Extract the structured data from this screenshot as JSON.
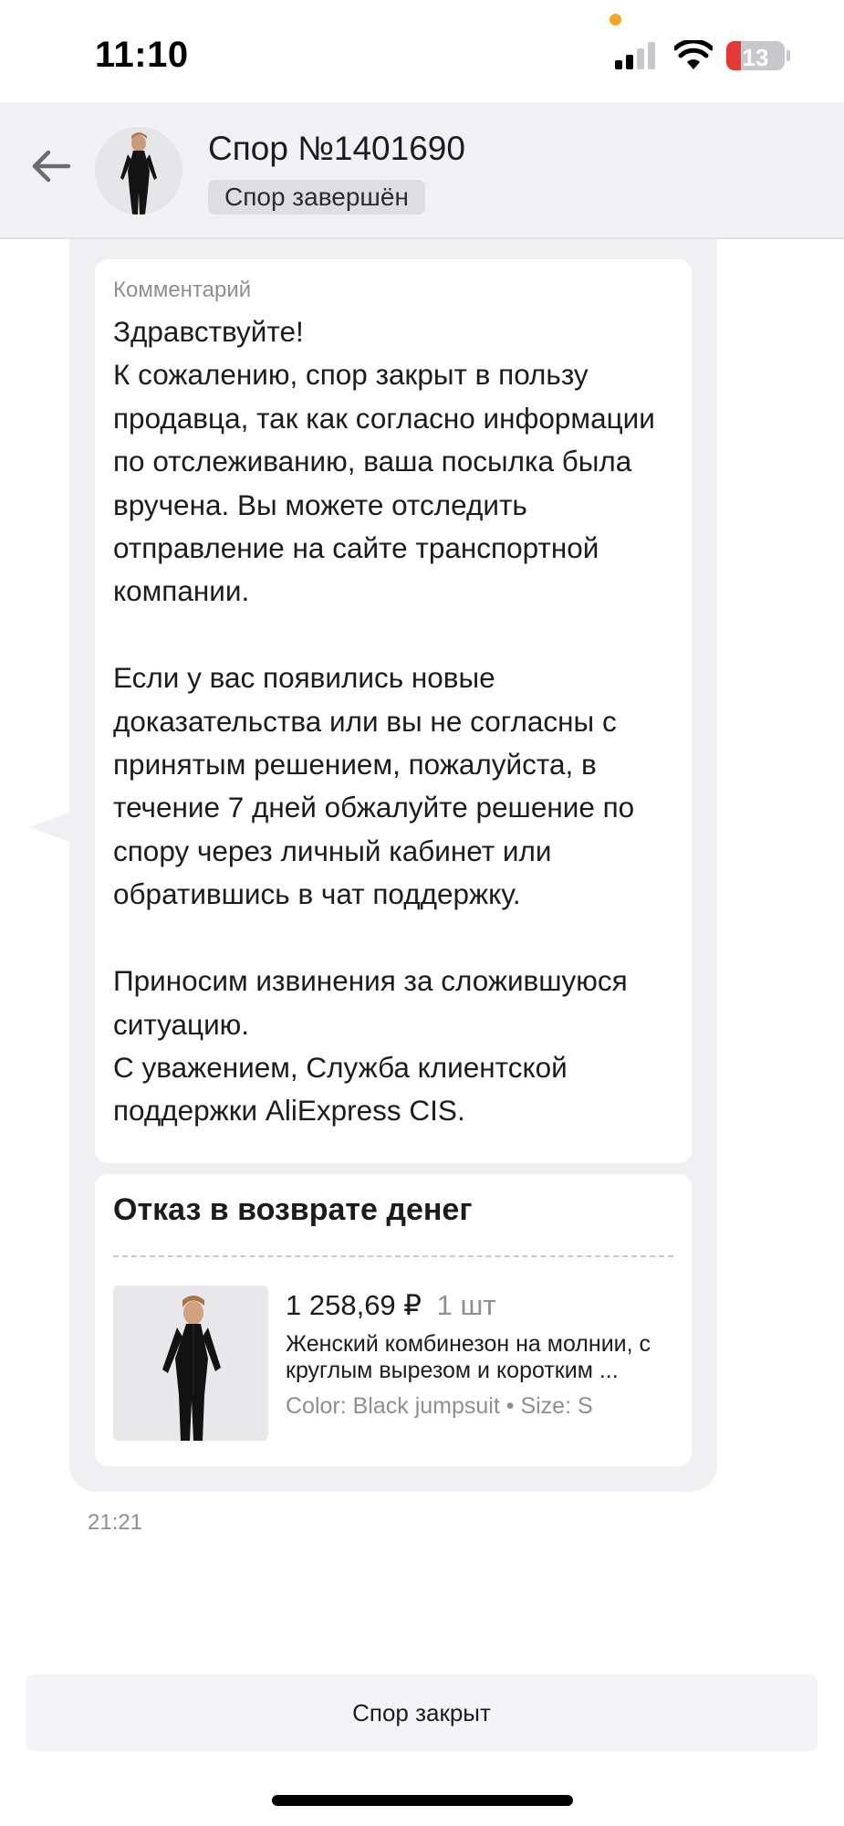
{
  "status_bar": {
    "time": "11:10",
    "battery_level": "13",
    "icons": [
      "cellular-signal-icon",
      "wifi-icon",
      "battery-icon"
    ]
  },
  "header": {
    "back_icon": "arrow-left-icon",
    "title": "Спор №1401690",
    "status_badge": "Спор завершён"
  },
  "message": {
    "comment_label": "Комментарий",
    "comment_text": "Здравствуйте!\nК сожалению, спор закрыт в пользу продавца, так как согласно информации по отслеживанию, ваша посылка была вручена. Вы можете отследить отправление на сайте транспортной компании.\n\nЕсли у вас появились новые доказательства или вы не согласны с принятым решением, пожалуйста, в течение 7 дней обжалуйте решение по спору через личный кабинет или обратившись в чат поддержку.\n\nПриносим извинения за сложившуюся ситуацию.\nС уважением, Служба клиентской поддержки AliExpress CIS.",
    "refund_title": "Отказ в возврате денег",
    "product": {
      "price": "1 258,69 ₽",
      "quantity": "1 шт",
      "name": "Женский комбинезон на молнии, с круглым вырезом и коротким ...",
      "variant": "Color: Black jumpsuit • Size: S"
    },
    "time": "21:21"
  },
  "footer": {
    "button_label": "Спор закрыт"
  },
  "colors": {
    "header_bg": "#f2f2f4",
    "bubble_bg": "#f0f0f2",
    "card_bg": "#ffffff",
    "muted_text": "#8e8e93",
    "battery_low": "#e53935",
    "notification_dot": "#f5a623"
  }
}
